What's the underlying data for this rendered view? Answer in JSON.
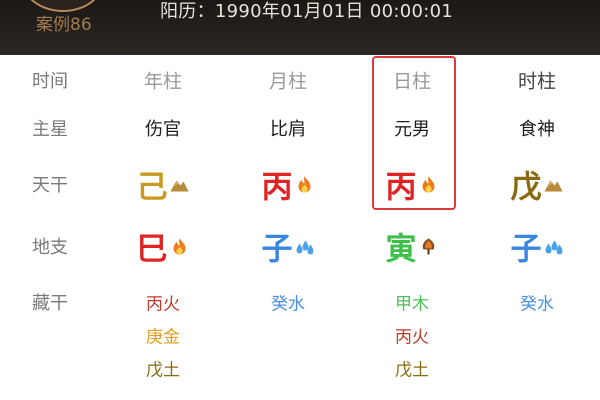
{
  "header": {
    "case_label": "案例86",
    "date_label": "阳历：1990年01月01日 00:00:01"
  },
  "row_labels": [
    "时间",
    "主星",
    "天干",
    "地支",
    "藏干"
  ],
  "columns": [
    {
      "head": "年柱",
      "star": "伤官",
      "stem": {
        "char": "己",
        "color": "#c99a1e",
        "element_icon": "earth-mound-icon"
      },
      "branch": {
        "char": "巳",
        "color": "#e02424",
        "element_icon": "fire-icon"
      },
      "hidden": [
        {
          "text": "丙火",
          "color": "#c0392b"
        },
        {
          "text": "庚金",
          "color": "#e2a020"
        },
        {
          "text": "戊土",
          "color": "#8a6a10"
        }
      ]
    },
    {
      "head": "月柱",
      "star": "比肩",
      "stem": {
        "char": "丙",
        "color": "#e02424",
        "element_icon": "fire-icon"
      },
      "branch": {
        "char": "子",
        "color": "#3a86e0",
        "element_icon": "water-drops-icon"
      },
      "hidden": [
        {
          "text": "癸水",
          "color": "#4a90e2"
        }
      ]
    },
    {
      "head": "日柱",
      "star": "元男",
      "stem": {
        "char": "丙",
        "color": "#e02424",
        "element_icon": "fire-icon"
      },
      "branch": {
        "char": "寅",
        "color": "#3cc04a",
        "element_icon": "wood-tree-icon"
      },
      "hidden": [
        {
          "text": "甲木",
          "color": "#4cc25a"
        },
        {
          "text": "丙火",
          "color": "#c0392b"
        },
        {
          "text": "戊土",
          "color": "#8a6a10"
        }
      ]
    },
    {
      "head": "时柱",
      "star": "食神",
      "stem": {
        "char": "戊",
        "color": "#8a6a10",
        "element_icon": "earth-mound-icon"
      },
      "branch": {
        "char": "子",
        "color": "#3a86e0",
        "element_icon": "water-drops-icon"
      },
      "hidden": [
        {
          "text": "癸水",
          "color": "#4a90e2"
        }
      ]
    }
  ],
  "highlight_color": "#dc3a3a"
}
